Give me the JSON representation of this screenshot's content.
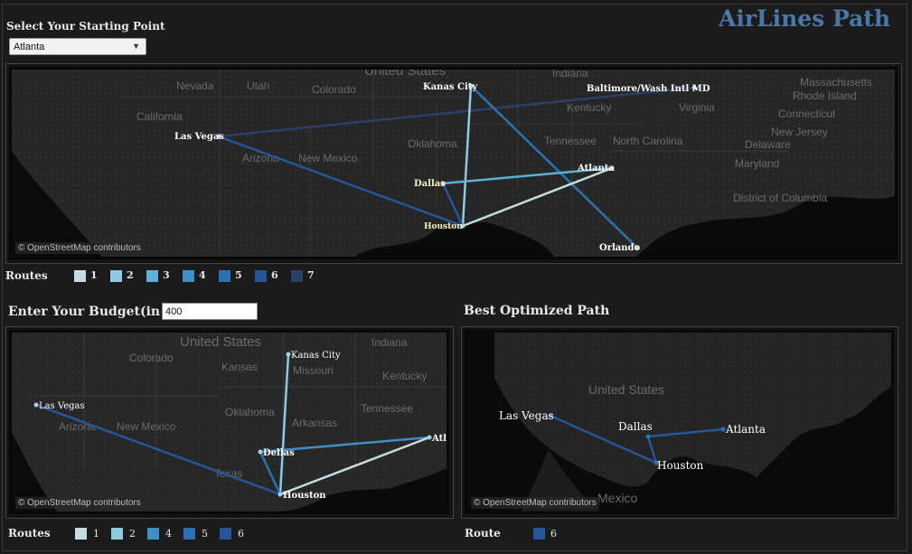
{
  "header": {
    "start_label": "Select Your Starting Point",
    "app_title": "AirLines Path"
  },
  "start_select": {
    "value": "Atlanta"
  },
  "map_attribution": "© OpenStreetMap contributors",
  "top_map": {
    "states": [
      "Nevada",
      "Utah",
      "Colorado",
      "United States",
      "Indiana",
      "California",
      "Kentucky",
      "Virginia",
      "Arizona",
      "New Mexico",
      "Oklahoma",
      "Tennessee",
      "North Carolina",
      "Massachusetts",
      "Rhode Island",
      "Connecticut",
      "New Jersey",
      "Delaware",
      "Maryland",
      "District of Columbia"
    ],
    "cities": [
      "Kanas City",
      "Baltimore/Wash Intl MD",
      "Las Vegas",
      "Dallas",
      "Atlanta",
      "Houston",
      "Orlando"
    ]
  },
  "top_legend": {
    "title": "Routes",
    "items": [
      {
        "label": "1",
        "color": "#c5dde0"
      },
      {
        "label": "2",
        "color": "#8fcbe0"
      },
      {
        "label": "3",
        "color": "#5fb0d8"
      },
      {
        "label": "4",
        "color": "#3f8fc4"
      },
      {
        "label": "5",
        "color": "#2b72b4"
      },
      {
        "label": "6",
        "color": "#25569a"
      },
      {
        "label": "7",
        "color": "#2a3f6a"
      }
    ]
  },
  "budget": {
    "label": "Enter Your Budget(in $)",
    "value": "400"
  },
  "best_path": {
    "label": "Best Optimized Path"
  },
  "bottom_left_map": {
    "states": [
      "United States",
      "Indiana",
      "Colorado",
      "Kansas",
      "Missouri",
      "Kentucky",
      "Oklahoma",
      "Arkansas",
      "Tennessee",
      "Arizona",
      "New Mexico",
      "Texas"
    ],
    "cities": [
      "Kanas City",
      "Las Vegas",
      "Dellas",
      "Atla",
      "Houston"
    ]
  },
  "bottom_left_legend": {
    "title": "Routes",
    "items": [
      {
        "label": "1",
        "color": "#c5dde0"
      },
      {
        "label": "2",
        "color": "#8fcbe0"
      },
      {
        "label": "4",
        "color": "#3f8fc4"
      },
      {
        "label": "5",
        "color": "#2b72b4"
      },
      {
        "label": "6",
        "color": "#25569a"
      }
    ]
  },
  "bottom_right_map": {
    "states": [
      "United States",
      "Mexico"
    ],
    "cities": [
      "Las Vegas",
      "Dallas",
      "Atlanta",
      "Houston"
    ]
  },
  "bottom_right_legend": {
    "title": "Route",
    "items": [
      {
        "label": "6",
        "color": "#25569a"
      }
    ]
  }
}
